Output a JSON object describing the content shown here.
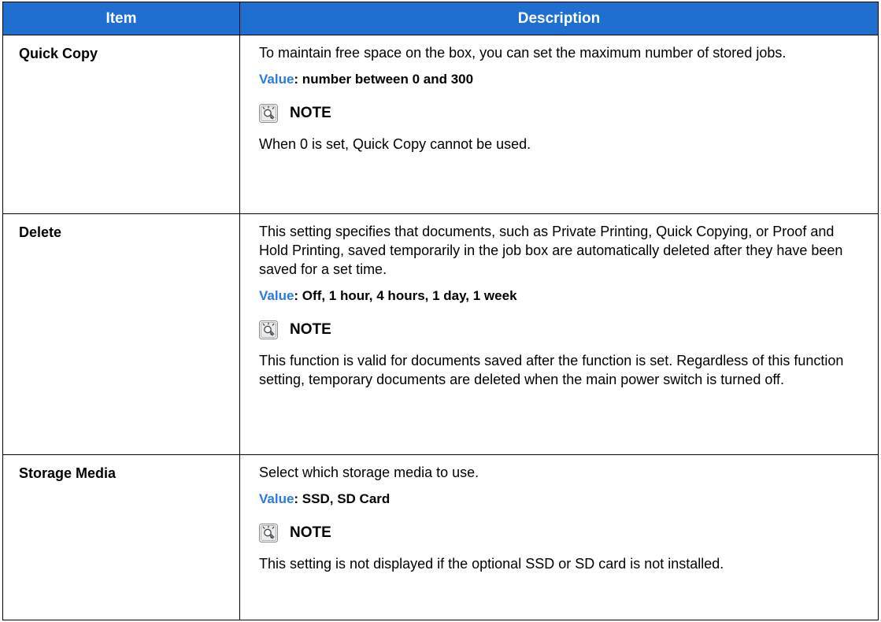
{
  "table": {
    "headers": {
      "item": "Item",
      "description": "Description"
    },
    "rows": [
      {
        "item": "Quick Copy",
        "description": "To maintain free space on the box, you can set the maximum number of stored jobs.",
        "value_key": "Value",
        "value_text": ": number between 0 and 300",
        "note_label": "NOTE",
        "note_text": "When 0 is set, Quick Copy cannot be used."
      },
      {
        "item": "Delete",
        "description": "This setting specifies that documents, such as Private Printing, Quick Copying, or Proof and Hold Printing, saved temporarily in the job box are automatically deleted after they have been saved for a set time.",
        "value_key": "Value",
        "value_text": ": Off, 1 hour, 4 hours, 1 day, 1 week",
        "note_label": "NOTE",
        "note_text": "This function is valid for documents saved after the function is set. Regardless of this function setting, temporary documents are deleted when the main power switch is turned off."
      },
      {
        "item": "Storage Media",
        "description": "Select which storage media to use.",
        "value_key": "Value",
        "value_text": ": SSD, SD Card",
        "note_label": "NOTE",
        "note_text": "This setting is not displayed if the optional SSD or SD card is not installed."
      }
    ]
  },
  "colors": {
    "header_bg": "#1f6fd0",
    "value_key": "#2a7ae2"
  },
  "icons": {
    "note": "lightbulb-note-icon"
  }
}
